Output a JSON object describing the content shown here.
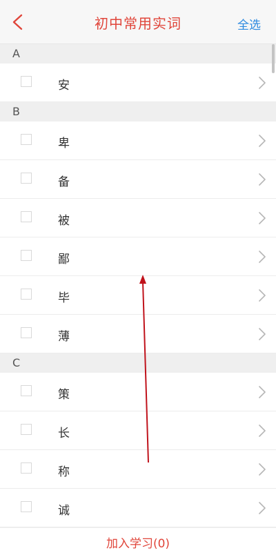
{
  "header": {
    "title": "初中常用实词",
    "select_all_label": "全选",
    "back_icon": "chevron-left-icon"
  },
  "sections": [
    {
      "letter": "A",
      "items": [
        "安"
      ]
    },
    {
      "letter": "B",
      "items": [
        "卑",
        "备",
        "被",
        "鄙",
        "毕",
        "薄"
      ]
    },
    {
      "letter": "C",
      "items": [
        "策",
        "长",
        "称",
        "诚"
      ]
    }
  ],
  "footer": {
    "add_label": "加入学习(0)"
  },
  "colors": {
    "title": "#e0453a",
    "select_all": "#2d8ae0",
    "annotation_arrow": "#c0121b"
  }
}
